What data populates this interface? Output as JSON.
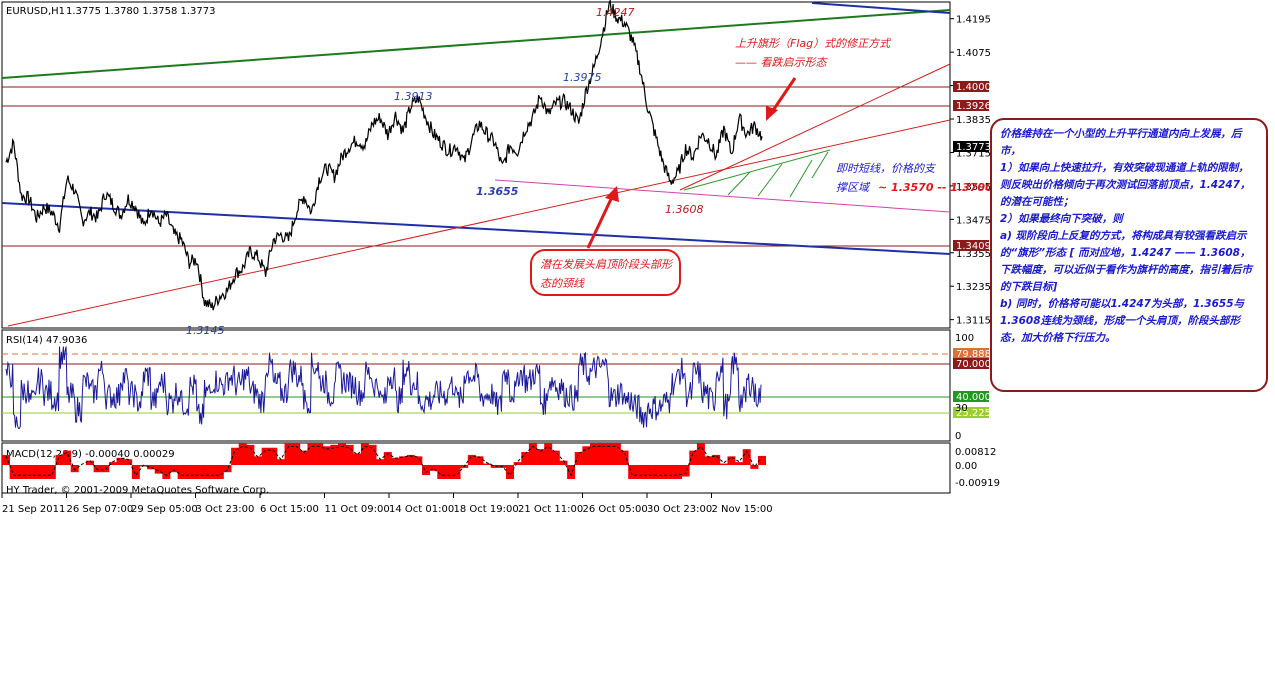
{
  "header": {
    "symbol": "EURUSD,H1",
    "ohlc": "1.3775 1.3780 1.3758 1.3773"
  },
  "chart_data": [
    {
      "type": "line",
      "name": "EURUSD H1 price",
      "ylim": [
        1.3085,
        1.4255
      ],
      "y_ticks": [
        1.4195,
        1.4075,
        1.3955,
        1.3835,
        1.3715,
        1.3595,
        1.3475,
        1.3355,
        1.3235,
        1.3115
      ],
      "x_ticks": [
        "21 Sep 2011",
        "26 Sep 07:00",
        "29 Sep 05:00",
        "3 Oct 23:00",
        "6 Oct 15:00",
        "11 Oct 09:00",
        "14 Oct 01:00",
        "18 Oct 19:00",
        "21 Oct 11:00",
        "26 Oct 05:00",
        "30 Oct 23:00",
        "2 Nov 15:00"
      ],
      "price_path": [
        [
          0,
          1.368
        ],
        [
          1,
          1.375
        ],
        [
          2,
          1.356
        ],
        [
          3,
          1.355
        ],
        [
          4,
          1.348
        ],
        [
          5,
          1.352
        ],
        [
          6,
          1.35
        ],
        [
          7,
          1.345
        ],
        [
          8,
          1.362
        ],
        [
          9,
          1.358
        ],
        [
          10,
          1.347
        ],
        [
          11,
          1.35
        ],
        [
          12,
          1.348
        ],
        [
          13,
          1.357
        ],
        [
          14,
          1.353
        ],
        [
          15,
          1.349
        ],
        [
          16,
          1.355
        ],
        [
          17,
          1.352
        ],
        [
          18,
          1.345
        ],
        [
          19,
          1.352
        ],
        [
          20,
          1.346
        ],
        [
          21,
          1.349
        ],
        [
          22,
          1.342
        ],
        [
          23,
          1.34
        ],
        [
          24,
          1.332
        ],
        [
          25,
          1.333
        ],
        [
          26,
          1.318
        ],
        [
          27,
          1.316
        ],
        [
          28,
          1.32
        ],
        [
          29,
          1.322
        ],
        [
          30,
          1.328
        ],
        [
          31,
          1.33
        ],
        [
          32,
          1.336
        ],
        [
          33,
          1.334
        ],
        [
          34,
          1.328
        ],
        [
          35,
          1.34
        ],
        [
          36,
          1.342
        ],
        [
          37,
          1.34
        ],
        [
          38,
          1.35
        ],
        [
          39,
          1.356
        ],
        [
          40,
          1.35
        ],
        [
          41,
          1.362
        ],
        [
          42,
          1.366
        ],
        [
          43,
          1.363
        ],
        [
          44,
          1.37
        ],
        [
          45,
          1.374
        ],
        [
          46,
          1.376
        ],
        [
          47,
          1.374
        ],
        [
          48,
          1.382
        ],
        [
          49,
          1.384
        ],
        [
          50,
          1.378
        ],
        [
          51,
          1.385
        ],
        [
          52,
          1.379
        ],
        [
          53,
          1.388
        ],
        [
          54,
          1.391
        ],
        [
          55,
          1.384
        ],
        [
          56,
          1.378
        ],
        [
          57,
          1.375
        ],
        [
          58,
          1.372
        ],
        [
          59,
          1.374
        ],
        [
          60,
          1.368
        ],
        [
          61,
          1.376
        ],
        [
          62,
          1.382
        ],
        [
          63,
          1.378
        ],
        [
          64,
          1.375
        ],
        [
          65,
          1.366
        ],
        [
          66,
          1.374
        ],
        [
          67,
          1.372
        ],
        [
          68,
          1.38
        ],
        [
          69,
          1.384
        ],
        [
          70,
          1.392
        ],
        [
          71,
          1.385
        ],
        [
          72,
          1.389
        ],
        [
          73,
          1.39
        ],
        [
          74,
          1.387
        ],
        [
          75,
          1.382
        ],
        [
          76,
          1.394
        ],
        [
          77,
          1.402
        ],
        [
          78,
          1.413
        ],
        [
          79,
          1.4247
        ],
        [
          80,
          1.42
        ],
        [
          81,
          1.418
        ],
        [
          82,
          1.412
        ],
        [
          83,
          1.402
        ],
        [
          84,
          1.388
        ],
        [
          85,
          1.378
        ],
        [
          86,
          1.368
        ],
        [
          87,
          1.3608
        ],
        [
          88,
          1.364
        ],
        [
          89,
          1.373
        ],
        [
          90,
          1.37
        ],
        [
          91,
          1.378
        ],
        [
          92,
          1.376
        ],
        [
          93,
          1.37
        ],
        [
          94,
          1.38
        ],
        [
          95,
          1.371
        ],
        [
          96,
          1.384
        ],
        [
          97,
          1.378
        ],
        [
          98,
          1.381
        ],
        [
          99,
          1.3773
        ]
      ],
      "lines": [
        {
          "name": "upper-channel-green",
          "color": "#1f7a1f"
        },
        {
          "name": "lower-channel-blue",
          "color": "#1f2fa8"
        },
        {
          "name": "top-blue-line",
          "color": "#1f2fa8"
        },
        {
          "name": "red-trend-1",
          "color": "#d42020"
        },
        {
          "name": "red-trend-2",
          "color": "#d42020"
        },
        {
          "name": "neckline-magenta",
          "color": "#d040b0"
        }
      ],
      "horizontal_levels": [
        {
          "value": 1.4,
          "label": "1.4000",
          "color": "#8b1a1a"
        },
        {
          "value": 1.3926,
          "label": "1.3926",
          "color": "#8b1a1a"
        },
        {
          "value": 1.3409,
          "label": "1.3409",
          "color": "#8b1a1a"
        }
      ],
      "current_price": "1.3773",
      "price_labels": [
        "1.4247",
        "1.3975",
        "1.3913",
        "1.3655",
        "1.3608",
        "1.3145"
      ],
      "annotations": {
        "flag_title": "上升旗形（Flag）式的修正方式",
        "flag_sub": "—— 看跌启示形态",
        "support_1": "即时短线，价格的支",
        "support_2": "撑区域",
        "support_range": "~ 1.3570 -- 1.3700",
        "hs_1": "潜在发展头肩顶阶段头部形",
        "hs_2": "态的颈线"
      }
    },
    {
      "type": "line",
      "name": "RSI",
      "title": "RSI(14) 47.9036",
      "ylim": [
        0,
        100
      ],
      "y_ticks": [
        "100",
        "70",
        "30",
        "0"
      ],
      "levels": [
        {
          "value": 79.8883,
          "label": "79.8883",
          "color": "#e07030",
          "style": "dashed"
        },
        {
          "value": 70,
          "label": "70.0000",
          "color": "#8b1a1a",
          "style": "solid"
        },
        {
          "value": 40,
          "label": "40.0000",
          "color": "#1f9a1f",
          "style": "solid"
        },
        {
          "value": 25.2252,
          "label": "25.2252",
          "color": "#9acd32",
          "style": "solid"
        }
      ],
      "extra_ticks": [
        "30"
      ]
    },
    {
      "type": "bar",
      "name": "MACD",
      "title": "MACD(12,26,9) -0.00040 0.00029",
      "y_ticks": [
        "0.00812",
        "0.00",
        "-0.00919"
      ],
      "bar_color": "#ff0000",
      "signal_color": "#000000"
    }
  ],
  "footer": "HY Trader, © 2001-2009 MetaQuotes Software Corp.",
  "note": {
    "lines": [
      "价格维持在一个小型的上升平行通道内向上发展，后市，",
      "1）如果向上快速拉升，有效突破现通道上轨的限制，则反映出价格倾向于再次测试回落前顶点，1.4247，的潜在可能性；",
      "2）如果最终向下突破，则",
      "a) 现阶段向上反复的方式，将构成具有较强看跌启示的“旗形”形态 [ 而对应地，1.4247 —— 1.3608，下跌幅度，可以近似于看作为旗杆的高度，指引着后市的下跌目标]",
      "b) 同时，价格将可能以1.4247为头部，1.3655与1.3608连线为颈线，形成一个头肩顶，阶段头部形态，加大价格下行压力。"
    ]
  }
}
